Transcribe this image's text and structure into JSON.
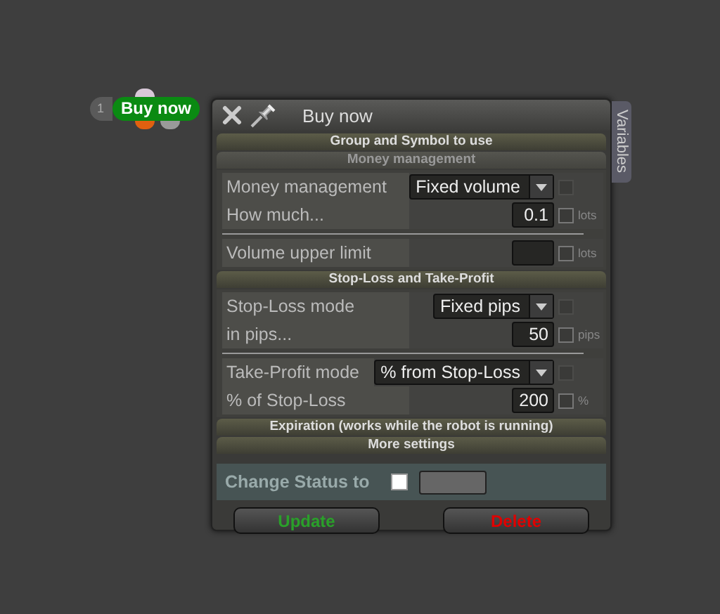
{
  "node": {
    "number": "1",
    "label": "Buy now"
  },
  "dialog": {
    "title": "Buy now",
    "side_tab": "Variables",
    "sections": [
      {
        "title": "Group and Symbol to use",
        "kind": "group"
      },
      {
        "title": "Money management",
        "kind": "subgroup",
        "rows": [
          {
            "kind": "select",
            "label": "Money management",
            "value": "Fixed volume",
            "checked": false,
            "disabled": true
          },
          {
            "kind": "number",
            "label": "How much...",
            "value": "0.1",
            "unit": "lots",
            "checked": false,
            "disabled": false
          },
          {
            "kind": "number",
            "label": "Volume upper limit",
            "unit": "lots",
            "checked": false,
            "disabled": false,
            "separator_before": true
          }
        ]
      },
      {
        "title": "Stop-Loss and Take-Profit",
        "kind": "group",
        "rows": [
          {
            "kind": "select",
            "label": "Stop-Loss mode",
            "value": "Fixed pips",
            "checked": false,
            "disabled": true
          },
          {
            "kind": "number",
            "label": "in pips...",
            "value": "50",
            "unit": "pips",
            "checked": false,
            "disabled": false
          },
          {
            "kind": "select",
            "label": "Take-Profit mode",
            "value": "% from Stop-Loss",
            "checked": false,
            "disabled": true,
            "separator_before": true
          },
          {
            "kind": "number",
            "label": "% of Stop-Loss",
            "value": "200",
            "unit": "%",
            "checked": false,
            "disabled": false
          }
        ]
      },
      {
        "title": "Expiration (works while the robot is running)",
        "kind": "group"
      },
      {
        "title": "More settings",
        "kind": "group"
      }
    ],
    "status": {
      "label": "Change Status to",
      "checked": false
    },
    "buttons": [
      {
        "label": "Update",
        "kind": "confirm"
      },
      {
        "label": "Delete",
        "kind": "danger"
      }
    ]
  }
}
